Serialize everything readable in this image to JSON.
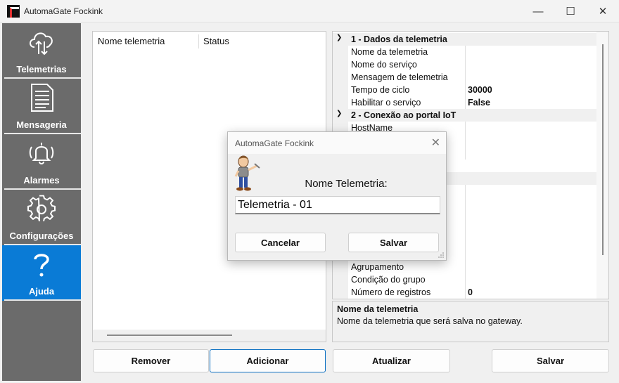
{
  "window": {
    "title": "AutomaGate Fockink",
    "minimize": "—",
    "maximize": "☐",
    "close": "✕"
  },
  "sidebar": {
    "items": [
      {
        "label": "Telemetrias",
        "icon": "cloud-transfer-icon",
        "active": false
      },
      {
        "label": "Mensageria",
        "icon": "document-icon",
        "active": false
      },
      {
        "label": "Alarmes",
        "icon": "bell-icon",
        "active": false
      },
      {
        "label": "Configurações",
        "icon": "gear-icon",
        "active": false
      },
      {
        "label": "Ajuda",
        "icon": "question-mark-icon",
        "active": true
      }
    ]
  },
  "list": {
    "columns": [
      "Nome telemetria",
      "Status"
    ]
  },
  "properties": {
    "categories": [
      {
        "label": "1 - Dados da telemetria"
      },
      {
        "label": "2 - Conexão ao portal IoT"
      }
    ],
    "rows": [
      {
        "name": "Nome da telemetria",
        "value": ""
      },
      {
        "name": "Nome do serviço",
        "value": ""
      },
      {
        "name": "Mensagem de telemetria",
        "value": ""
      },
      {
        "name": "Tempo de ciclo",
        "value": "30000"
      },
      {
        "name": "Habilitar o serviço",
        "value": "False"
      },
      {
        "name": "HostName",
        "value": ""
      },
      {
        "name": "Agrupamento",
        "value": ""
      },
      {
        "name": "Condição do grupo",
        "value": ""
      },
      {
        "name": "Número de registros",
        "value": "0"
      }
    ]
  },
  "description": {
    "title": "Nome da telemetria",
    "text": "Nome da telemetria que será salva no gateway."
  },
  "buttons": {
    "remove": "Remover",
    "add": "Adicionar",
    "update": "Atualizar",
    "save": "Salvar"
  },
  "dialog": {
    "title": "AutomaGate Fockink",
    "close": "✕",
    "label": "Nome Telemetria:",
    "input_value": "Telemetria - 01",
    "cancel": "Cancelar",
    "save": "Salvar"
  },
  "colors": {
    "sidebar_bg": "#6b6b6b",
    "active_item": "#0a7bd6",
    "focus_border": "#0a6fc2"
  }
}
